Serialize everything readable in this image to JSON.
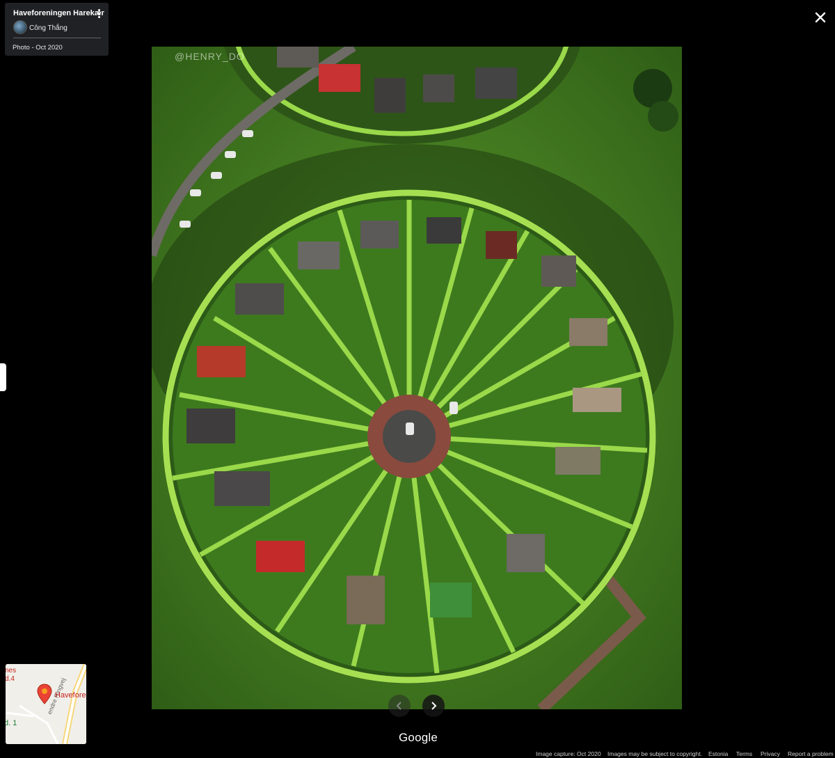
{
  "info_card": {
    "place_name": "Haveforeningen Harekær",
    "author": "Công Thắng",
    "photo_date": "Photo - Oct 2020"
  },
  "photo": {
    "watermark": "@HENRY_DO"
  },
  "google_logo": "Google",
  "minimap": {
    "place_label": "Havefore",
    "label_es": "nes",
    "label_d4": "d.4",
    "label_d1": "d. 1",
    "road_label": "endre Ringvej"
  },
  "footer": {
    "image_capture": "Image capture: Oct 2020",
    "copyright": "Images may be subject to copyright.",
    "country": "Estonia",
    "terms": "Terms",
    "privacy": "Privacy",
    "report": "Report a problem"
  },
  "colors": {
    "background": "#000000",
    "card": "#202124",
    "lawn": "#4f8a24",
    "hedge": "#8fd13f",
    "pin": "#ea4335"
  },
  "icons": [
    "more-vert-icon",
    "close-icon",
    "chevron-left-icon",
    "chevron-right-icon",
    "map-pin-icon"
  ]
}
